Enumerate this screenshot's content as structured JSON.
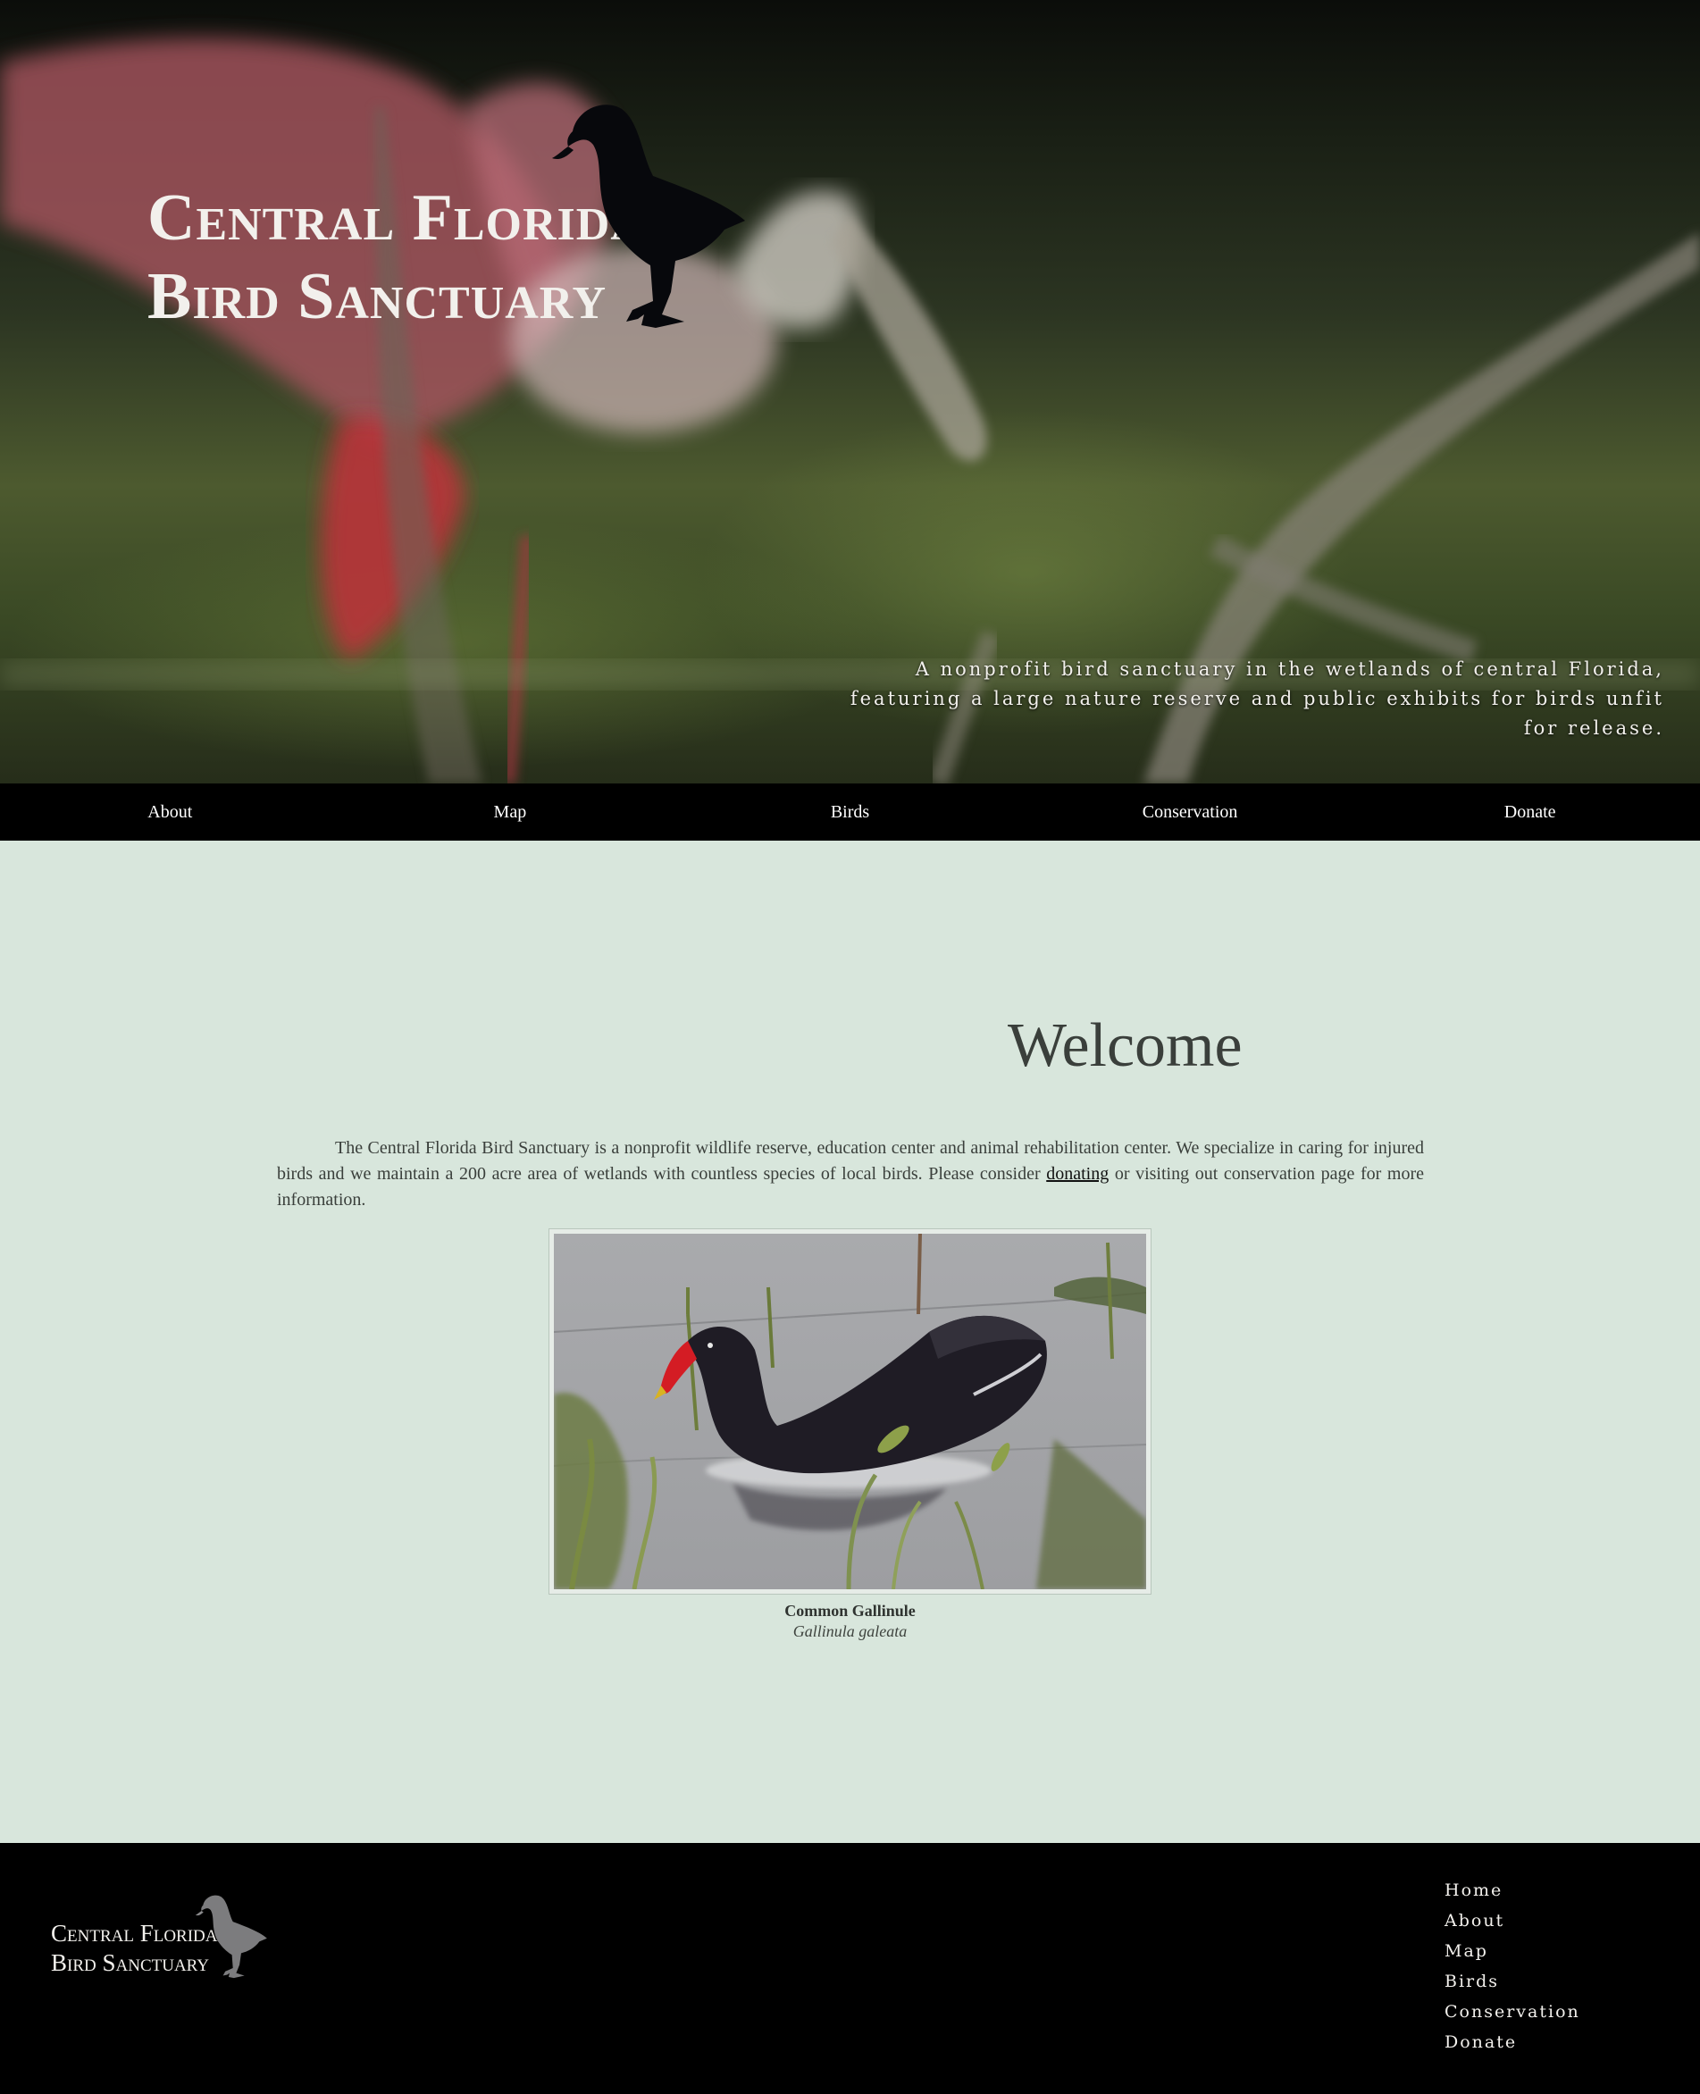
{
  "hero": {
    "title_line1": "Central Florida",
    "title_line2": "Bird Sanctuary",
    "tagline": "A nonprofit bird sanctuary in the wetlands of central Florida, featuring a large nature reserve and public exhibits for birds unfit for release."
  },
  "nav": {
    "items": [
      {
        "label": "About"
      },
      {
        "label": "Map"
      },
      {
        "label": "Birds"
      },
      {
        "label": "Conservation"
      },
      {
        "label": "Donate"
      }
    ]
  },
  "main": {
    "heading": "Welcome",
    "intro_before": "The Central Florida Bird Sanctuary is a nonprofit wildlife reserve, education center and animal rehabilitation center. We specialize in caring for injured birds and we maintain a 200 acre area of wetlands with countless species of local birds. Please consider ",
    "intro_link": "donating",
    "intro_after": " or visiting out conservation page for more information.",
    "figure": {
      "common_name": "Common Gallinule",
      "scientific_name": "Gallinula galeata"
    }
  },
  "footer": {
    "title_line1": "Central Florida",
    "title_line2": "Bird Sanctuary",
    "links": [
      {
        "label": "Home"
      },
      {
        "label": "About"
      },
      {
        "label": "Map"
      },
      {
        "label": "Birds"
      },
      {
        "label": "Conservation"
      },
      {
        "label": "Donate"
      }
    ]
  },
  "colors": {
    "page_background": "#d8e6dc",
    "nav_background": "#000000",
    "text": "#3a3f3b",
    "hero_text": "#f2f0ec"
  }
}
